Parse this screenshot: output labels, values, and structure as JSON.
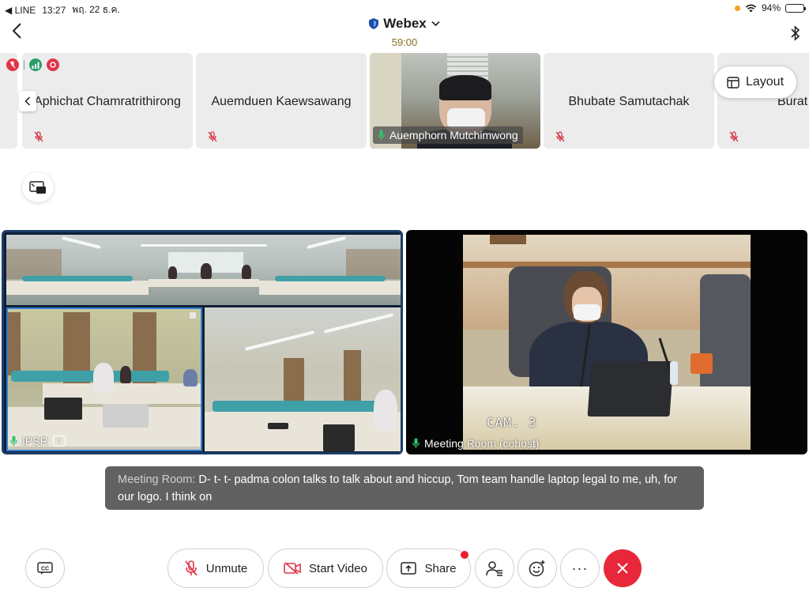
{
  "status_bar": {
    "back_app": "◀ LINE",
    "time": "13:27",
    "date": "พฤ. 22 ธ.ค.",
    "battery": "94%",
    "battery_level": 0.94
  },
  "header": {
    "app_title": "Webex",
    "timer": "59:00"
  },
  "participants": [
    {
      "name": "Aphichat Chamratrithirong",
      "muted": true,
      "video": false
    },
    {
      "name": "Auemduen Kaewsawang",
      "muted": true,
      "video": false
    },
    {
      "name": "Auemphorn Mutchimwong",
      "muted": false,
      "video": true
    },
    {
      "name": "Bhubate Samutachak",
      "muted": true,
      "video": false
    },
    {
      "name": "Burat",
      "muted": true,
      "video": false
    }
  ],
  "layout_button": {
    "label": "Layout"
  },
  "main_tiles": {
    "left": {
      "label": "IPSR"
    },
    "right": {
      "label": "Meeting Room (cohost)",
      "overlay_text": "CAM. 3"
    }
  },
  "caption": {
    "speaker": "Meeting Room:",
    "text": "D- t- t- padma colon talks to talk about and hiccup, Tom team handle laptop legal to me, uh, for our logo. I think on"
  },
  "controls": {
    "unmute": "Unmute",
    "start_video": "Start Video",
    "share": "Share",
    "more": "···"
  },
  "colors": {
    "accent_red": "#e8283a",
    "active_border": "#1b3d66",
    "timer": "#8a6d1a"
  }
}
